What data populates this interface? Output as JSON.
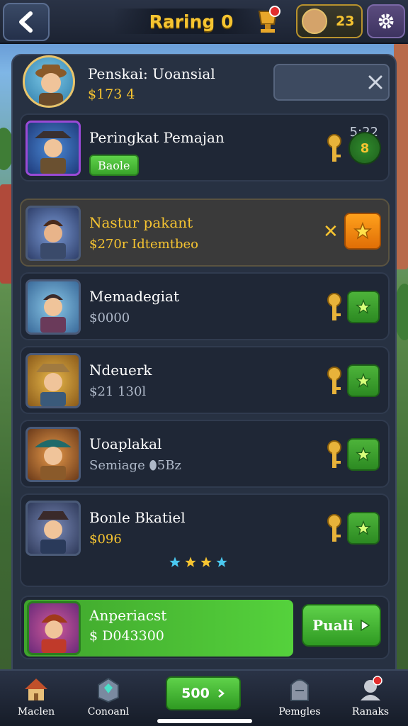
{
  "header": {
    "title": "Raring 0",
    "coins": "23",
    "notification_count": ""
  },
  "profile": {
    "name": "Penskai: Uoansial",
    "money": "$173 4"
  },
  "rows": [
    {
      "name": "Peringkat Pemajan",
      "badge": "Baole",
      "time": "5:22"
    },
    {
      "name": "Nastur pakant",
      "sub": "$270r Idtemtbeo"
    },
    {
      "name": "Memadegiat",
      "sub": "$0000"
    },
    {
      "name": "Ndeuerk",
      "sub": "$21 130l"
    },
    {
      "name": "Uoaplakal",
      "sub": "Semiage ⬮5Bz"
    },
    {
      "name": "Bonle Bkatiel",
      "sub": "$096"
    }
  ],
  "player": {
    "name": "Anperiacst",
    "money": "$ D043300",
    "button_label": "Puali"
  },
  "nav": {
    "items": [
      "Maclen",
      "Conoanl",
      "Pemgles",
      "Ranaks"
    ],
    "center_label": "500"
  },
  "colors": {
    "accent_gold": "#f6c431",
    "button_green": "#4db33a",
    "button_orange": "#ffa11c",
    "panel": "#273142"
  }
}
